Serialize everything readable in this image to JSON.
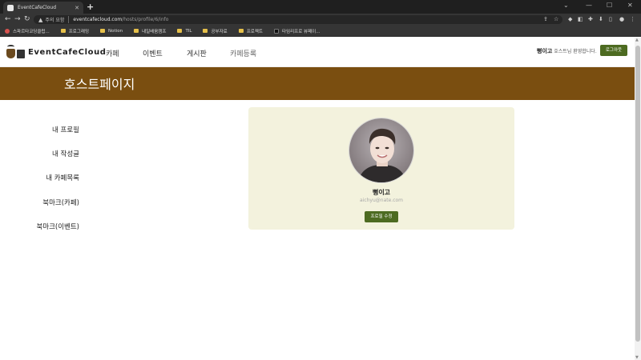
{
  "browser": {
    "tab_title": "EventCafeCloud",
    "new_tab": "+",
    "insecure_label": "주의 요함",
    "url_host": "eventcafecloud.com",
    "url_path": "/hosts/profile/6/info",
    "bookmarks": [
      "스파르타코딩클럽...",
      "프로그래밍",
      "Notion",
      "내일배움캠프",
      "TIL",
      "공부자료",
      "프로젝트",
      "타임리프로 뷰페이..."
    ]
  },
  "site": {
    "logo_text": "EventCafeCloud",
    "nav": [
      "카페",
      "이벤트",
      "게시판",
      "카페등록"
    ],
    "greeting_name": "뻥이고",
    "greeting_suffix": " 호스트님 환영합니다.",
    "logout_label": "로그아웃"
  },
  "banner": {
    "title": "호스트페이지"
  },
  "sidebar": {
    "items": [
      "내 프로필",
      "내 작성글",
      "내 카페목록",
      "북마크(카페)",
      "북마크(이벤트)"
    ]
  },
  "profile": {
    "name": "뻥이고",
    "email": "aichyu@nate.com",
    "edit_label": "프로필 수정"
  },
  "colors": {
    "brand_brown": "#7a4e10",
    "brand_green": "#4d6b21",
    "card_bg": "#f3f2dd"
  }
}
